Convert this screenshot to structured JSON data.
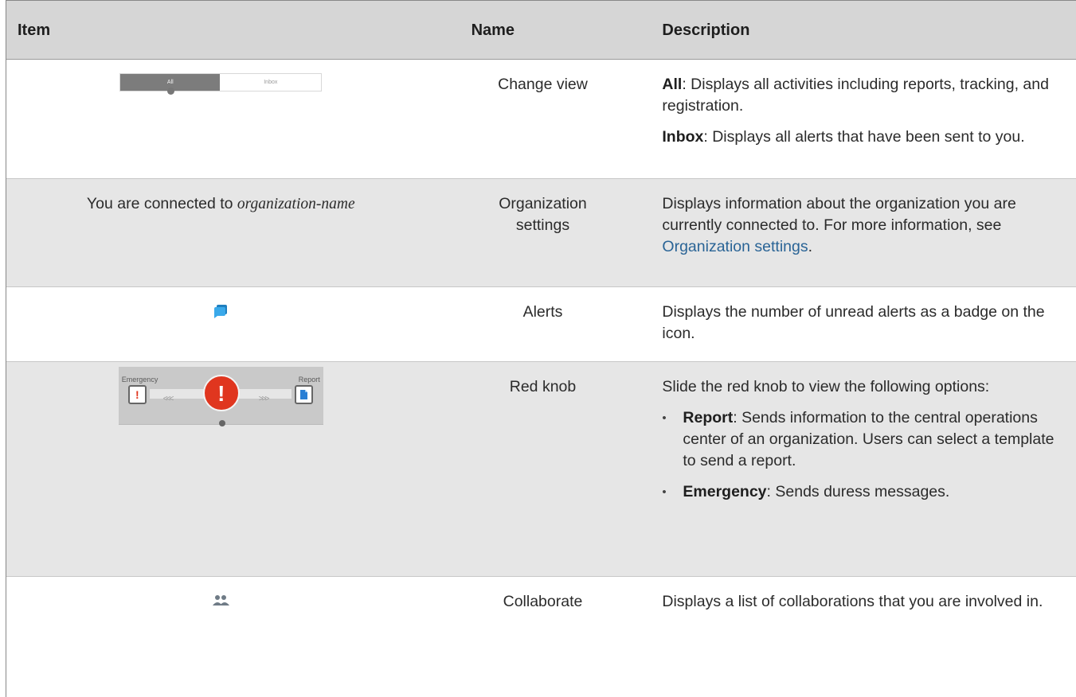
{
  "headers": {
    "item": "Item",
    "name": "Name",
    "description": "Description"
  },
  "rows": [
    {
      "toggle": {
        "active": "All",
        "inactive": "Inbox"
      },
      "name": "Change view",
      "desc": [
        {
          "term": "All",
          "text": ": Displays all activities including reports, tracking, and registration."
        },
        {
          "term": "Inbox",
          "text": ": Displays all alerts that have been sent to you."
        }
      ]
    },
    {
      "item_prefix": "You are connected to ",
      "item_italic": "organization-name",
      "name": "Organization settings",
      "desc_text": "Displays information about the organization you are currently connected to. For more information, see ",
      "desc_link": "Organization settings",
      "desc_end": "."
    },
    {
      "icon": "alerts-chat-icon",
      "name": "Alerts",
      "desc_text": "Displays the number of unread alerts as a badge on the icon."
    },
    {
      "knob": {
        "left_label": "Emergency",
        "right_label": "Report",
        "left_arrows": "<<<",
        "right_arrows": ">>>",
        "left_glyph": "!",
        "center_glyph": "!"
      },
      "name": "Red knob",
      "desc_text": "Slide the red knob to view the following options:",
      "bullets": [
        {
          "term": "Report",
          "text": ": Sends information to the central operations center of an organization. Users can select a template to send a report."
        },
        {
          "term": "Emergency",
          "text": ": Sends duress messages."
        }
      ]
    },
    {
      "icon": "collaborate-people-icon",
      "name": "Collaborate",
      "desc_text": "Displays a list of collaborations that you are involved in."
    }
  ],
  "colors": {
    "accent_blue": "#2c9ae0",
    "knob_red": "#e0361f",
    "link": "#2a6496"
  }
}
